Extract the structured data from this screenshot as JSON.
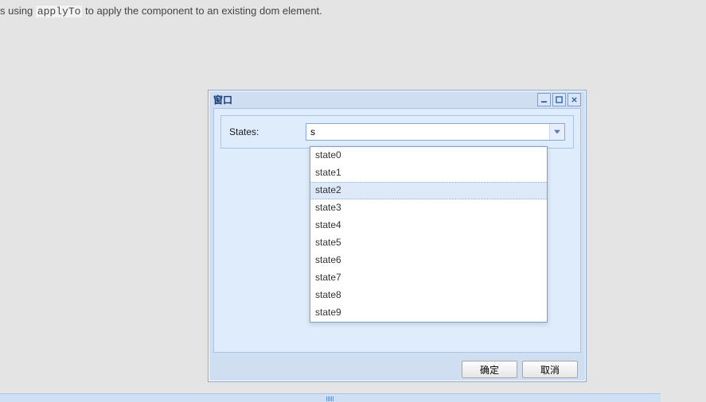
{
  "bg_text": {
    "prefix": "s using ",
    "code": "applyTo",
    "suffix": " to apply the component to an existing dom element."
  },
  "window": {
    "title": "窗口"
  },
  "form": {
    "label": "States:",
    "combo_value": "s"
  },
  "dropdown": {
    "items": [
      "state0",
      "state1",
      "state2",
      "state3",
      "state4",
      "state5",
      "state6",
      "state7",
      "state8",
      "state9"
    ],
    "highlighted_index": 2
  },
  "buttons": {
    "ok_label": "确定",
    "cancel_label": "取消"
  }
}
